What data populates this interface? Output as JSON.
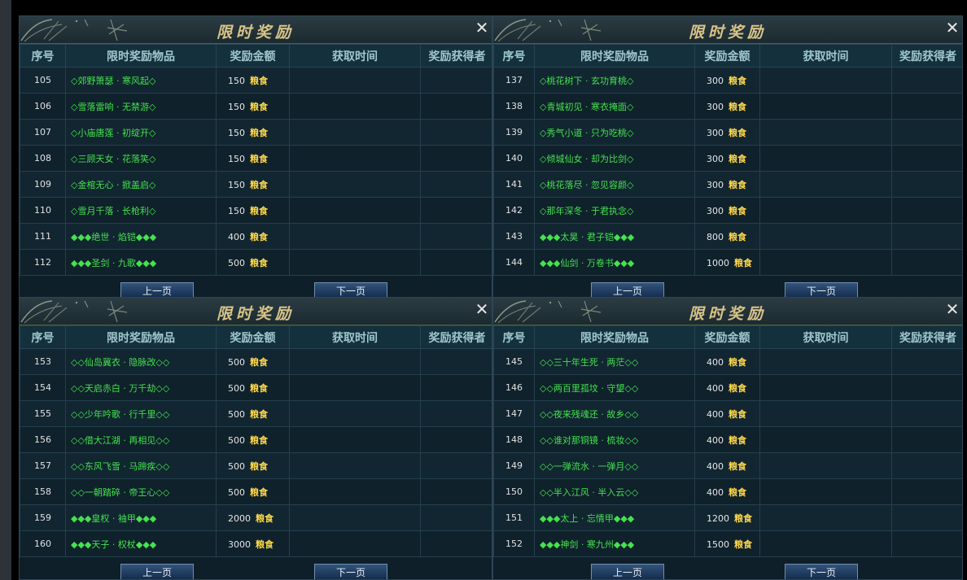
{
  "panels": [
    {
      "title": "限时奖励",
      "columns": [
        "序号",
        "限时奖励物品",
        "奖励金额",
        "获取时间",
        "奖励获得者"
      ],
      "rows": [
        {
          "id": "105",
          "item": "◇郊野箫瑟 · 寒风起◇",
          "amount": "150",
          "currency": "粮食",
          "time": "",
          "winner": ""
        },
        {
          "id": "106",
          "item": "◇雪落雷响 · 无禁游◇",
          "amount": "150",
          "currency": "粮食",
          "time": "",
          "winner": ""
        },
        {
          "id": "107",
          "item": "◇小庙唐莲 · 初绽开◇",
          "amount": "150",
          "currency": "粮食",
          "time": "",
          "winner": ""
        },
        {
          "id": "108",
          "item": "◇三顾天女 · 花落笑◇",
          "amount": "150",
          "currency": "粮食",
          "time": "",
          "winner": ""
        },
        {
          "id": "109",
          "item": "◇金棺无心 · 掀盖启◇",
          "amount": "150",
          "currency": "粮食",
          "time": "",
          "winner": ""
        },
        {
          "id": "110",
          "item": "◇雪月千落 · 长枪利◇",
          "amount": "150",
          "currency": "粮食",
          "time": "",
          "winner": ""
        },
        {
          "id": "111",
          "item": "◆◆◆绝世 · 焰铠◆◆◆",
          "amount": "400",
          "currency": "粮食",
          "time": "",
          "winner": ""
        },
        {
          "id": "112",
          "item": "◆◆◆圣剑 · 九歌◆◆◆",
          "amount": "500",
          "currency": "粮食",
          "time": "",
          "winner": ""
        }
      ],
      "prev_label": "上一页",
      "next_label": "下一页"
    },
    {
      "title": "限时奖励",
      "columns": [
        "序号",
        "限时奖励物品",
        "奖励金额",
        "获取时间",
        "奖励获得者"
      ],
      "rows": [
        {
          "id": "137",
          "item": "◇桃花树下 · 玄功育桃◇",
          "amount": "300",
          "currency": "粮食",
          "time": "",
          "winner": ""
        },
        {
          "id": "138",
          "item": "◇青城初见 · 寒衣掩面◇",
          "amount": "300",
          "currency": "粮食",
          "time": "",
          "winner": ""
        },
        {
          "id": "139",
          "item": "◇秀气小道 · 只为吃桃◇",
          "amount": "300",
          "currency": "粮食",
          "time": "",
          "winner": ""
        },
        {
          "id": "140",
          "item": "◇倾城仙女 · 却为比剑◇",
          "amount": "300",
          "currency": "粮食",
          "time": "",
          "winner": ""
        },
        {
          "id": "141",
          "item": "◇桃花落尽 · 忽见容颜◇",
          "amount": "300",
          "currency": "粮食",
          "time": "",
          "winner": ""
        },
        {
          "id": "142",
          "item": "◇那年深冬 · 于君执念◇",
          "amount": "300",
          "currency": "粮食",
          "time": "",
          "winner": ""
        },
        {
          "id": "143",
          "item": "◆◆◆太昊 · 君子铠◆◆◆",
          "amount": "800",
          "currency": "粮食",
          "time": "",
          "winner": ""
        },
        {
          "id": "144",
          "item": "◆◆◆仙剑 · 万卷书◆◆◆",
          "amount": "1000",
          "currency": "粮食",
          "time": "",
          "winner": ""
        }
      ],
      "prev_label": "上一页",
      "next_label": "下一页"
    },
    {
      "title": "限时奖励",
      "columns": [
        "序号",
        "限时奖励物品",
        "奖励金额",
        "获取时间",
        "奖励获得者"
      ],
      "rows": [
        {
          "id": "153",
          "item": "◇◇仙岛冀衣 · 隐脉改◇◇",
          "amount": "500",
          "currency": "粮食",
          "time": "",
          "winner": ""
        },
        {
          "id": "154",
          "item": "◇◇天启赤白 · 万千劫◇◇",
          "amount": "500",
          "currency": "粮食",
          "time": "",
          "winner": ""
        },
        {
          "id": "155",
          "item": "◇◇少年吟歌 · 行千里◇◇",
          "amount": "500",
          "currency": "粮食",
          "time": "",
          "winner": ""
        },
        {
          "id": "156",
          "item": "◇◇借大江湖 · 再相见◇◇",
          "amount": "500",
          "currency": "粮食",
          "time": "",
          "winner": ""
        },
        {
          "id": "157",
          "item": "◇◇东风飞雪 · 马蹄疾◇◇",
          "amount": "500",
          "currency": "粮食",
          "time": "",
          "winner": ""
        },
        {
          "id": "158",
          "item": "◇◇一朝踏碎 · 帝王心◇◇",
          "amount": "500",
          "currency": "粮食",
          "time": "",
          "winner": ""
        },
        {
          "id": "159",
          "item": "◆◆◆皇权 · 袖甲◆◆◆",
          "amount": "2000",
          "currency": "粮食",
          "time": "",
          "winner": ""
        },
        {
          "id": "160",
          "item": "◆◆◆天子 · 权杖◆◆◆",
          "amount": "3000",
          "currency": "粮食",
          "time": "",
          "winner": ""
        }
      ],
      "prev_label": "上一页",
      "next_label": "下一页"
    },
    {
      "title": "限时奖励",
      "columns": [
        "序号",
        "限时奖励物品",
        "奖励金额",
        "获取时间",
        "奖励获得者"
      ],
      "rows": [
        {
          "id": "145",
          "item": "◇◇三十年生死 · 两茫◇◇",
          "amount": "400",
          "currency": "粮食",
          "time": "",
          "winner": ""
        },
        {
          "id": "146",
          "item": "◇◇两百里孤坟 · 守望◇◇",
          "amount": "400",
          "currency": "粮食",
          "time": "",
          "winner": ""
        },
        {
          "id": "147",
          "item": "◇◇夜来残魂还 · 故乡◇◇",
          "amount": "400",
          "currency": "粮食",
          "time": "",
          "winner": ""
        },
        {
          "id": "148",
          "item": "◇◇谁对那铜镜 · 梳妆◇◇",
          "amount": "400",
          "currency": "粮食",
          "time": "",
          "winner": ""
        },
        {
          "id": "149",
          "item": "◇◇一弹流水 · 一弹月◇◇",
          "amount": "400",
          "currency": "粮食",
          "time": "",
          "winner": ""
        },
        {
          "id": "150",
          "item": "◇◇半入江风 · 半入云◇◇",
          "amount": "400",
          "currency": "粮食",
          "time": "",
          "winner": ""
        },
        {
          "id": "151",
          "item": "◆◆◆太上 · 忘情甲◆◆◆",
          "amount": "1200",
          "currency": "粮食",
          "time": "",
          "winner": ""
        },
        {
          "id": "152",
          "item": "◆◆◆神剑 · 寒九州◆◆◆",
          "amount": "1500",
          "currency": "粮食",
          "time": "",
          "winner": ""
        }
      ],
      "prev_label": "上一页",
      "next_label": "下一页"
    }
  ]
}
